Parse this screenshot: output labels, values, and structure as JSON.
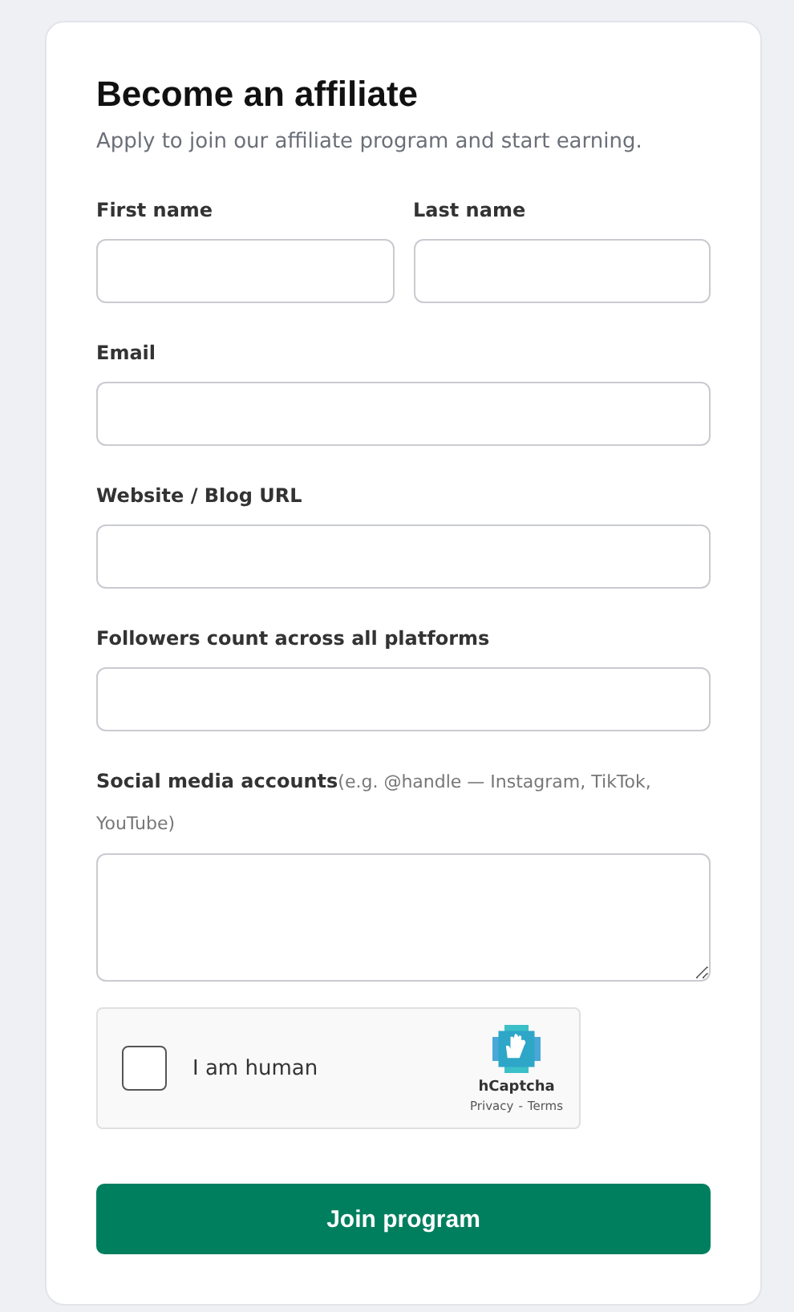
{
  "title": "Become an affiliate",
  "subtitle": "Apply to join our affiliate program and start earning.",
  "name_fields": [
    {
      "label": "First name"
    },
    {
      "label": "Last name"
    }
  ],
  "fields": [
    {
      "label": "Email",
      "kind": "input"
    },
    {
      "label": "Website / Blog URL",
      "kind": "input"
    },
    {
      "label": "Followers count across all platforms",
      "kind": "input"
    },
    {
      "label": "Social media accounts",
      "hint": "(e.g. @handle — Instagram, TikTok, YouTube)",
      "kind": "textarea"
    }
  ],
  "captcha": {
    "checked": false,
    "label": "I am human",
    "brand": "hCaptcha",
    "privacy": "Privacy",
    "separator": "-",
    "terms": "Terms"
  },
  "submit": "Join program"
}
